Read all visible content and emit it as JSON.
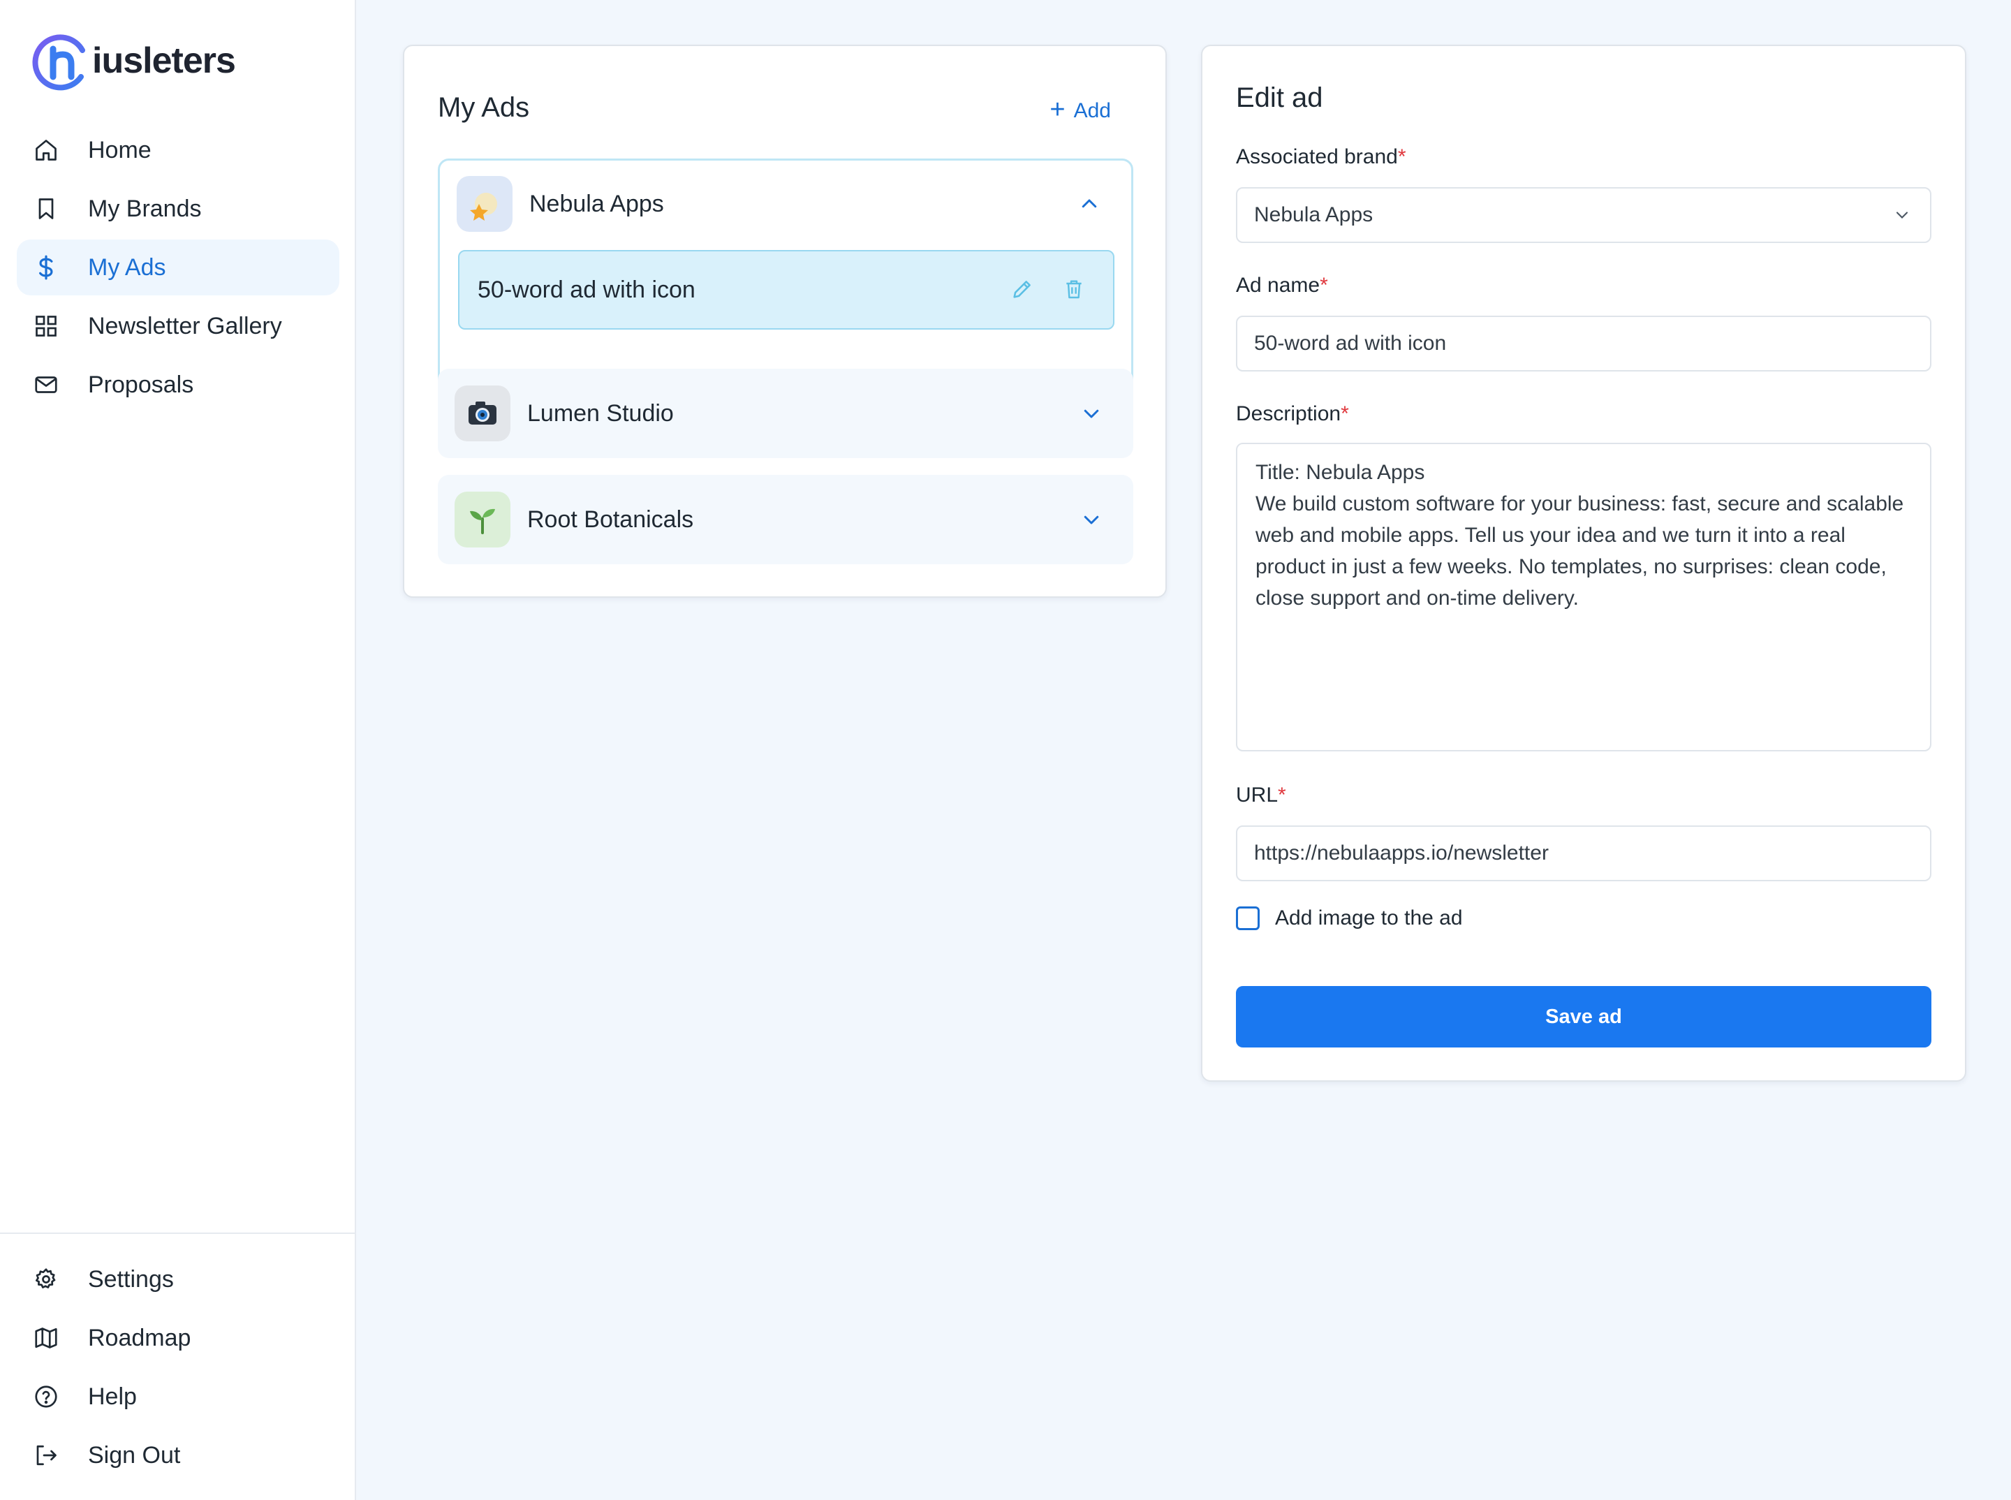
{
  "app": {
    "logo_text": "iusleters"
  },
  "sidebar": {
    "nav": [
      {
        "label": "Home",
        "icon": "home-icon"
      },
      {
        "label": "My Brands",
        "icon": "bookmark-icon"
      },
      {
        "label": "My Ads",
        "icon": "dollar-icon",
        "active": true
      },
      {
        "label": "Newsletter Gallery",
        "icon": "grid-icon"
      },
      {
        "label": "Proposals",
        "icon": "mail-icon"
      }
    ],
    "bottom": [
      {
        "label": "Settings",
        "icon": "gear-icon"
      },
      {
        "label": "Roadmap",
        "icon": "map-icon"
      },
      {
        "label": "Help",
        "icon": "help-circle-icon"
      },
      {
        "label": "Sign Out",
        "icon": "sign-out-icon"
      }
    ]
  },
  "ads_panel": {
    "title": "My Ads",
    "add_label": "Add",
    "brands": [
      {
        "name": "Nebula Apps",
        "icon": "star-moon-icon",
        "expanded": true,
        "ads": [
          {
            "name": "50-word ad with icon"
          }
        ]
      },
      {
        "name": "Lumen Studio",
        "icon": "camera-icon",
        "expanded": false
      },
      {
        "name": "Root Botanicals",
        "icon": "sprout-icon",
        "expanded": false
      }
    ]
  },
  "edit_panel": {
    "title": "Edit ad",
    "brand_label": "Associated brand",
    "brand_value": "Nebula Apps",
    "ad_name_label": "Ad name",
    "ad_name_value": "50-word ad with icon",
    "description_label": "Description",
    "description_value": "Title: Nebula Apps\nWe build custom software for your business: fast, secure and scalable web and mobile apps. Tell us your idea and we turn it into a real product in just a few weeks. No templates, no surprises: clean code, close support and on-time delivery.",
    "url_label": "URL",
    "url_value": "https://nebulaapps.io/newsletter",
    "required_mark": "*",
    "checkbox_label": "Add image to the ad",
    "checkbox_checked": false,
    "save_label": "Save ad"
  },
  "colors": {
    "accent": "#1a6fd4",
    "button": "#1a78f0",
    "required": "#e0393e",
    "active_nav_bg": "#eef6fe",
    "selected_ad_bg": "#d9f1fb"
  }
}
